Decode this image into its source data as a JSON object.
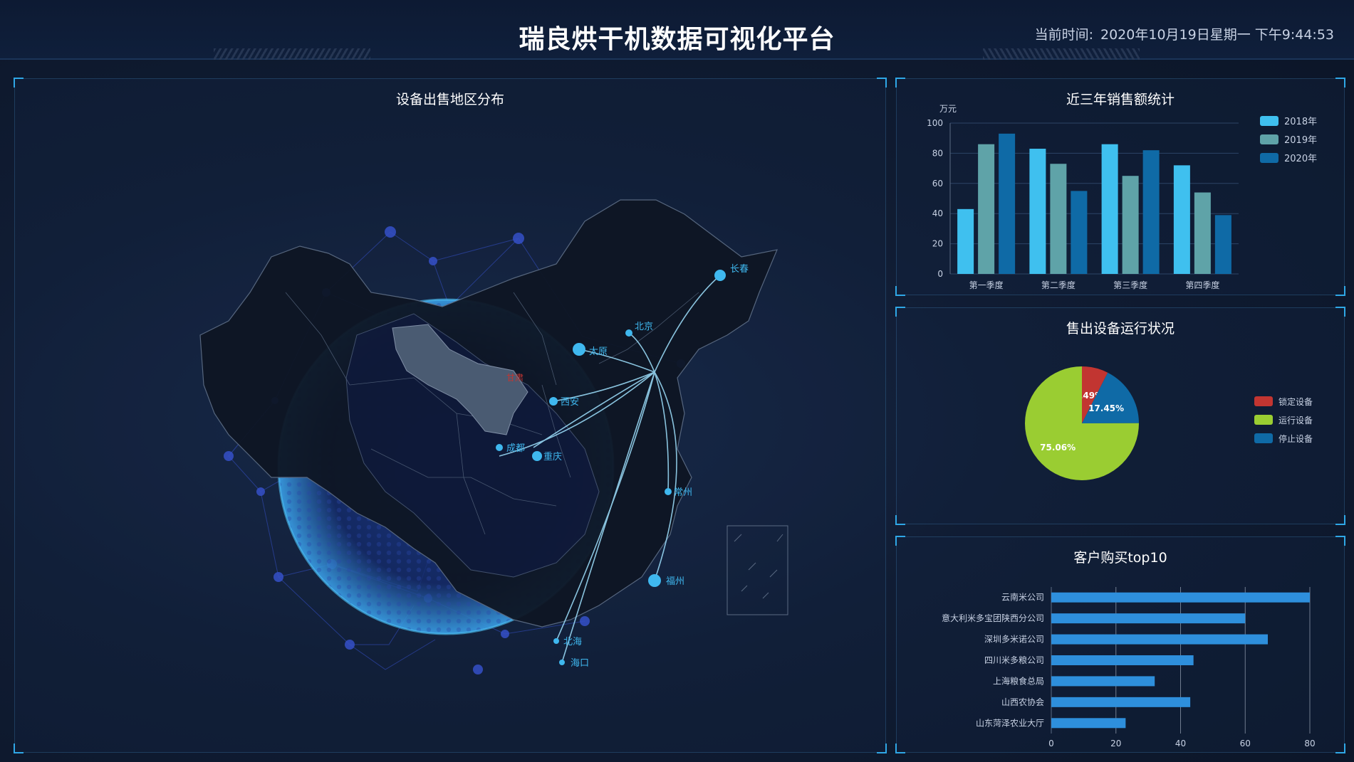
{
  "header": {
    "title": "瑞良烘干机数据可视化平台",
    "clock_label": "当前时间:",
    "clock_value": "2020年10月19日星期一 下午9:44:53"
  },
  "map_panel": {
    "title": "设备出售地区分布",
    "highlight_province": "甘肃",
    "cities": [
      "北京",
      "长春",
      "太原",
      "西安",
      "成都",
      "重庆",
      "常州",
      "福州",
      "北海",
      "海口"
    ],
    "colors": {
      "city": "#3fb8ef",
      "highlight": "#4a5b72",
      "province": "#0e1624"
    }
  },
  "sales_panel": {
    "title": "近三年销售额统计",
    "chart_data": {
      "type": "bar",
      "title": "近三年销售额统计",
      "ylabel": "万元",
      "ylim": [
        0,
        100
      ],
      "yticks": [
        0,
        20,
        40,
        60,
        80,
        100
      ],
      "categories": [
        "第一季度",
        "第二季度",
        "第三季度",
        "第四季度"
      ],
      "series": [
        {
          "name": "2018年",
          "color": "#3fc0ef",
          "values": [
            43,
            83,
            86,
            72
          ]
        },
        {
          "name": "2019年",
          "color": "#5fa3a8",
          "values": [
            86,
            73,
            65,
            54
          ]
        },
        {
          "name": "2020年",
          "color": "#0f6aa6",
          "values": [
            93,
            55,
            82,
            39
          ]
        }
      ],
      "legend": "top-right",
      "grid": true
    }
  },
  "status_panel": {
    "title": "售出设备运行状况",
    "chart_data": {
      "type": "pie",
      "title": "售出设备运行状况",
      "slices": [
        {
          "name": "锁定设备",
          "value": 7.49,
          "label": "7.49%",
          "color": "#c23531"
        },
        {
          "name": "停止设备",
          "value": 17.45,
          "label": "17.45%",
          "color": "#0f6aa6"
        },
        {
          "name": "运行设备",
          "value": 75.06,
          "label": "75.06%",
          "color": "#9acd32"
        }
      ],
      "legend_order": [
        "锁定设备",
        "运行设备",
        "停止设备"
      ],
      "legend": "right"
    }
  },
  "top_panel": {
    "title": "客户购买top10",
    "chart_data": {
      "type": "bar",
      "orientation": "horizontal",
      "title": "客户购买top10",
      "categories": [
        "云南米公司",
        "意大利米多宝团陕西分公司",
        "深圳多米诺公司",
        "四川米多粮公司",
        "上海粮食总局",
        "山西农协会",
        "山东菏泽农业大厅"
      ],
      "values": [
        80,
        60,
        67,
        44,
        32,
        43,
        23
      ],
      "xlim": [
        0,
        80
      ],
      "xticks": [
        0,
        20,
        40,
        60,
        80
      ],
      "color": "#2e8fdc",
      "grid": true
    }
  }
}
